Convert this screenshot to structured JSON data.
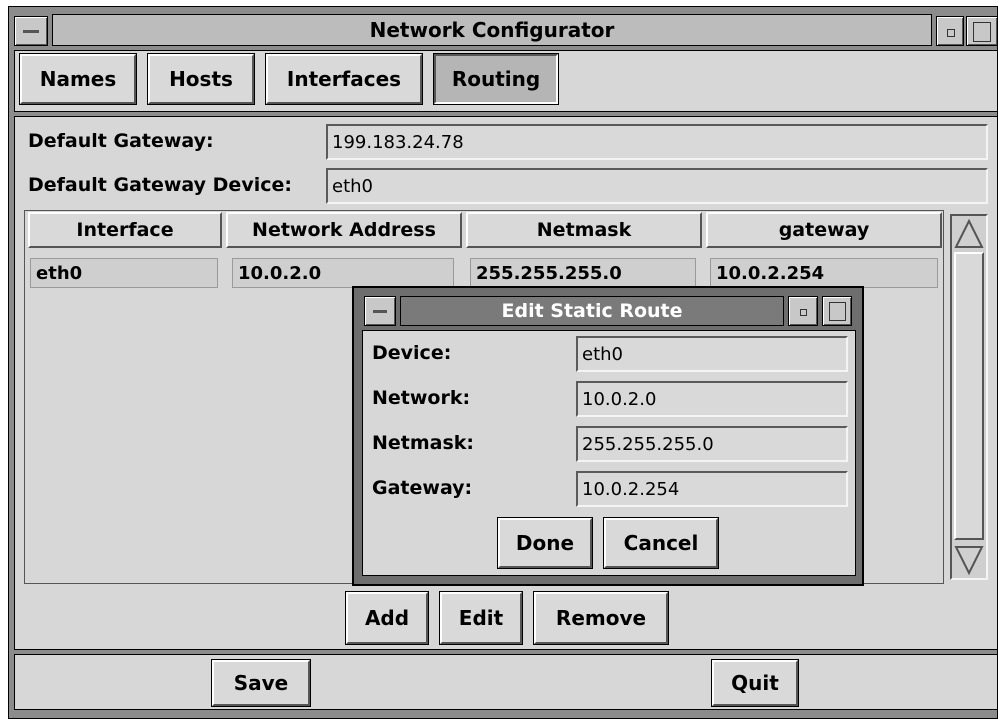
{
  "window": {
    "title": "Network Configurator",
    "tabs": [
      {
        "label": "Names"
      },
      {
        "label": "Hosts"
      },
      {
        "label": "Interfaces"
      },
      {
        "label": "Routing"
      }
    ],
    "active_tab": "Routing",
    "default_gateway_label": "Default Gateway:",
    "default_gateway_value": "199.183.24.78",
    "default_gateway_device_label": "Default Gateway Device:",
    "default_gateway_device_value": "eth0"
  },
  "routes_table": {
    "columns": [
      "Interface",
      "Network Address",
      "Netmask",
      "gateway"
    ],
    "rows": [
      [
        "eth0",
        "10.0.2.0",
        "255.255.255.0",
        "10.0.2.254"
      ]
    ]
  },
  "table_buttons": {
    "add": "Add",
    "edit": "Edit",
    "remove": "Remove"
  },
  "bottom_buttons": {
    "save": "Save",
    "quit": "Quit"
  },
  "dialog": {
    "title": "Edit Static Route",
    "fields": [
      {
        "label": "Device:",
        "value": "eth0"
      },
      {
        "label": "Network:",
        "value": "10.0.2.0"
      },
      {
        "label": "Netmask:",
        "value": "255.255.255.0"
      },
      {
        "label": "Gateway:",
        "value": "10.0.2.254"
      }
    ],
    "done": "Done",
    "cancel": "Cancel"
  },
  "colors": {
    "frame": "#8c8c8c",
    "panel": "#d7d7d7",
    "titlebar": "#bcbcbc",
    "dialog_titlebar": "#7a7a7a"
  }
}
